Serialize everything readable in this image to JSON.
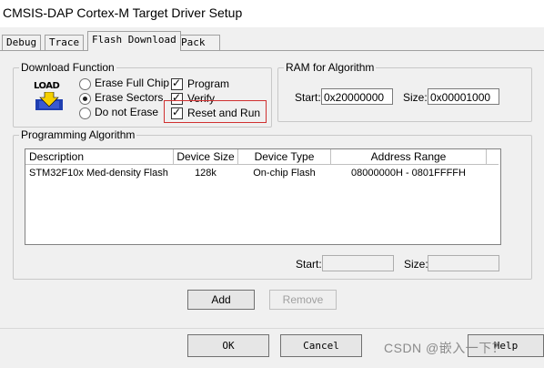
{
  "window": {
    "title": "CMSIS-DAP Cortex-M Target Driver Setup"
  },
  "tabs": [
    {
      "label": "Debug"
    },
    {
      "label": "Trace"
    },
    {
      "label": "Flash Download"
    },
    {
      "label": "Pack"
    }
  ],
  "download_function": {
    "legend": "Download Function",
    "load_icon_text": "LOAD",
    "erase_options": [
      {
        "label": "Erase Full Chip",
        "selected": false
      },
      {
        "label": "Erase Sectors",
        "selected": true
      },
      {
        "label": "Do not Erase",
        "selected": false
      }
    ],
    "checks": [
      {
        "label": "Program",
        "checked": true
      },
      {
        "label": "Verify",
        "checked": true
      },
      {
        "label": "Reset and Run",
        "checked": true
      }
    ]
  },
  "ram": {
    "legend": "RAM for Algorithm",
    "start_label": "Start:",
    "start_value": "0x20000000",
    "size_label": "Size:",
    "size_value": "0x00001000"
  },
  "programming": {
    "legend": "Programming Algorithm",
    "columns": [
      "Description",
      "Device Size",
      "Device Type",
      "Address Range"
    ],
    "rows": [
      [
        "STM32F10x Med-density Flash",
        "128k",
        "On-chip Flash",
        "08000000H - 0801FFFFH"
      ]
    ],
    "start_label": "Start:",
    "start_value": "",
    "size_label": "Size:",
    "size_value": ""
  },
  "buttons": {
    "add": "Add",
    "remove": "Remove",
    "ok": "OK",
    "cancel": "Cancel",
    "help": "Help"
  },
  "watermark": "CSDN @嵌入一下？",
  "colors": {
    "highlight": "#d03030",
    "icon_blue": "#1f3fb0",
    "icon_yellow": "#f5d000"
  }
}
